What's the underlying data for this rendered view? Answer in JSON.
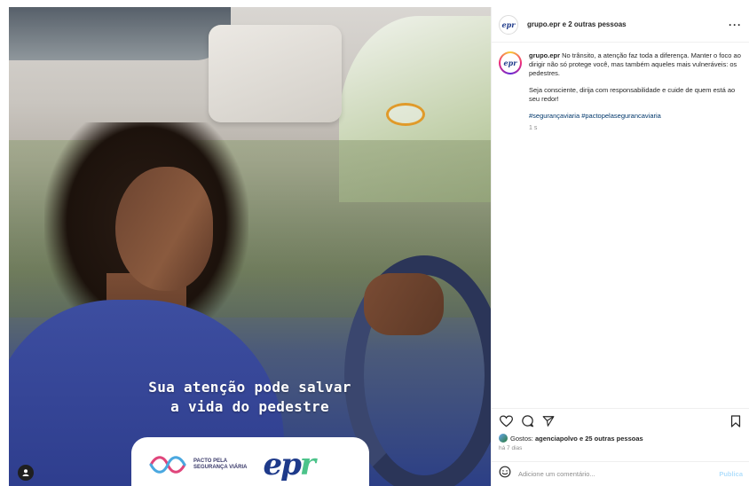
{
  "post": {
    "headline_line1": "Sua atenção pode salvar",
    "headline_line2": "a vida do pedestre",
    "partner_logo_line1": "PACTO PELA",
    "partner_logo_line2": "SEGURANÇA VIÁRIA",
    "brand_logo": "epr"
  },
  "header": {
    "account": "grupo.epr",
    "collaborators": "e 2 outras pessoas",
    "more_icon": "more-horizontal-icon"
  },
  "caption": {
    "username": "grupo.epr",
    "paragraph1": "No trânsito, a atenção faz toda a diferença. Manter o foco ao dirigir não só protege você, mas também aqueles mais vulneráveis: os pedestres.",
    "paragraph2": "Seja consciente, dirija com responsabilidade e cuide de quem está ao seu redor!",
    "hashtags": "#segurançaviaria #pactopelasegurancaviaria",
    "time": "1 s"
  },
  "actions": {
    "like_icon": "heart-icon",
    "comment_icon": "comment-icon",
    "share_icon": "send-icon",
    "save_icon": "bookmark-icon"
  },
  "likes": {
    "prefix": "Gostos:",
    "liker": "agenciapolvo",
    "suffix": "e 25 outras pessoas"
  },
  "posted_ago": "há 7 dias",
  "comment": {
    "placeholder": "Adicione um comentário...",
    "publish_label": "Publica",
    "emoji_icon": "emoji-icon"
  }
}
